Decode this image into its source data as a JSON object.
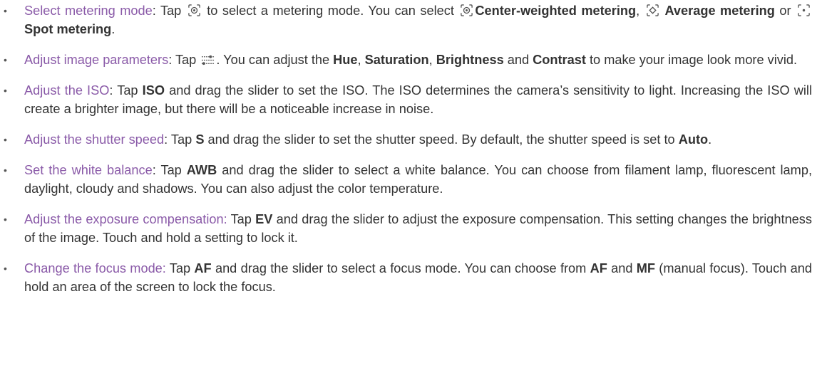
{
  "items": [
    {
      "lead": "Select metering mode",
      "parts": [
        {
          "t": "text",
          "v": ": Tap "
        },
        {
          "t": "icon",
          "icon": "center-weighted-metering-icon"
        },
        {
          "t": "text",
          "v": " to select a metering mode. You can select "
        },
        {
          "t": "icon",
          "icon": "center-weighted-metering-icon"
        },
        {
          "t": "bold",
          "v": "Center-weighted metering"
        },
        {
          "t": "text",
          "v": ", "
        },
        {
          "t": "icon",
          "icon": "average-metering-icon"
        },
        {
          "t": "bold",
          "v": " Average metering"
        },
        {
          "t": "text",
          "v": " or "
        },
        {
          "t": "icon",
          "icon": "spot-metering-icon"
        },
        {
          "t": "bold",
          "v": " Spot metering"
        },
        {
          "t": "text",
          "v": "."
        }
      ]
    },
    {
      "lead": "Adjust image parameters",
      "parts": [
        {
          "t": "text",
          "v": ": Tap "
        },
        {
          "t": "icon",
          "icon": "sliders-icon"
        },
        {
          "t": "text",
          "v": ". You can adjust the "
        },
        {
          "t": "bold",
          "v": "Hue"
        },
        {
          "t": "text",
          "v": ", "
        },
        {
          "t": "bold",
          "v": "Saturation"
        },
        {
          "t": "text",
          "v": ", "
        },
        {
          "t": "bold",
          "v": "Brightness"
        },
        {
          "t": "text",
          "v": " and "
        },
        {
          "t": "bold",
          "v": "Contrast"
        },
        {
          "t": "text",
          "v": " to make your image look more vivid."
        }
      ]
    },
    {
      "lead": "Adjust the ISO",
      "parts": [
        {
          "t": "text",
          "v": ": Tap "
        },
        {
          "t": "bold",
          "v": "ISO"
        },
        {
          "t": "text",
          "v": " and drag the slider to set the ISO. The ISO determines the camera’s sensitivity to light. Increasing the ISO will create a brighter image, but there will be a noticeable increase in noise."
        }
      ]
    },
    {
      "lead": "Adjust the shutter speed",
      "parts": [
        {
          "t": "text",
          "v": ": Tap "
        },
        {
          "t": "bold",
          "v": "S"
        },
        {
          "t": "text",
          "v": " and drag the slider to set the shutter speed. By default, the shutter speed is set to "
        },
        {
          "t": "bold",
          "v": "Auto"
        },
        {
          "t": "text",
          "v": "."
        }
      ]
    },
    {
      "lead": "Set the white balance",
      "parts": [
        {
          "t": "text",
          "v": ": Tap "
        },
        {
          "t": "bold",
          "v": "AWB"
        },
        {
          "t": "text",
          "v": " and drag the slider to select a white balance. You can choose from filament lamp, fluorescent lamp, daylight, cloudy and shadows. You can also adjust the color temperature."
        }
      ]
    },
    {
      "lead": "Adjust the exposure compensation:",
      "parts": [
        {
          "t": "text",
          "v": " Tap "
        },
        {
          "t": "bold",
          "v": "EV"
        },
        {
          "t": "text",
          "v": " and drag the slider to adjust the exposure compensation. This setting changes the brightness of the image. Touch and hold a setting to lock it."
        }
      ]
    },
    {
      "lead": "Change the focus mode:",
      "parts": [
        {
          "t": "text",
          "v": " Tap "
        },
        {
          "t": "bold",
          "v": "AF"
        },
        {
          "t": "text",
          "v": " and drag the slider to select a focus mode. You can choose from "
        },
        {
          "t": "bold",
          "v": "AF"
        },
        {
          "t": "text",
          "v": " and "
        },
        {
          "t": "bold",
          "v": "MF"
        },
        {
          "t": "text",
          "v": " (manual focus). Touch and hold an area of the screen to lock the focus."
        }
      ]
    }
  ],
  "colors": {
    "lead": "#8a5aa8",
    "body": "#333333",
    "icon": "#555555"
  }
}
